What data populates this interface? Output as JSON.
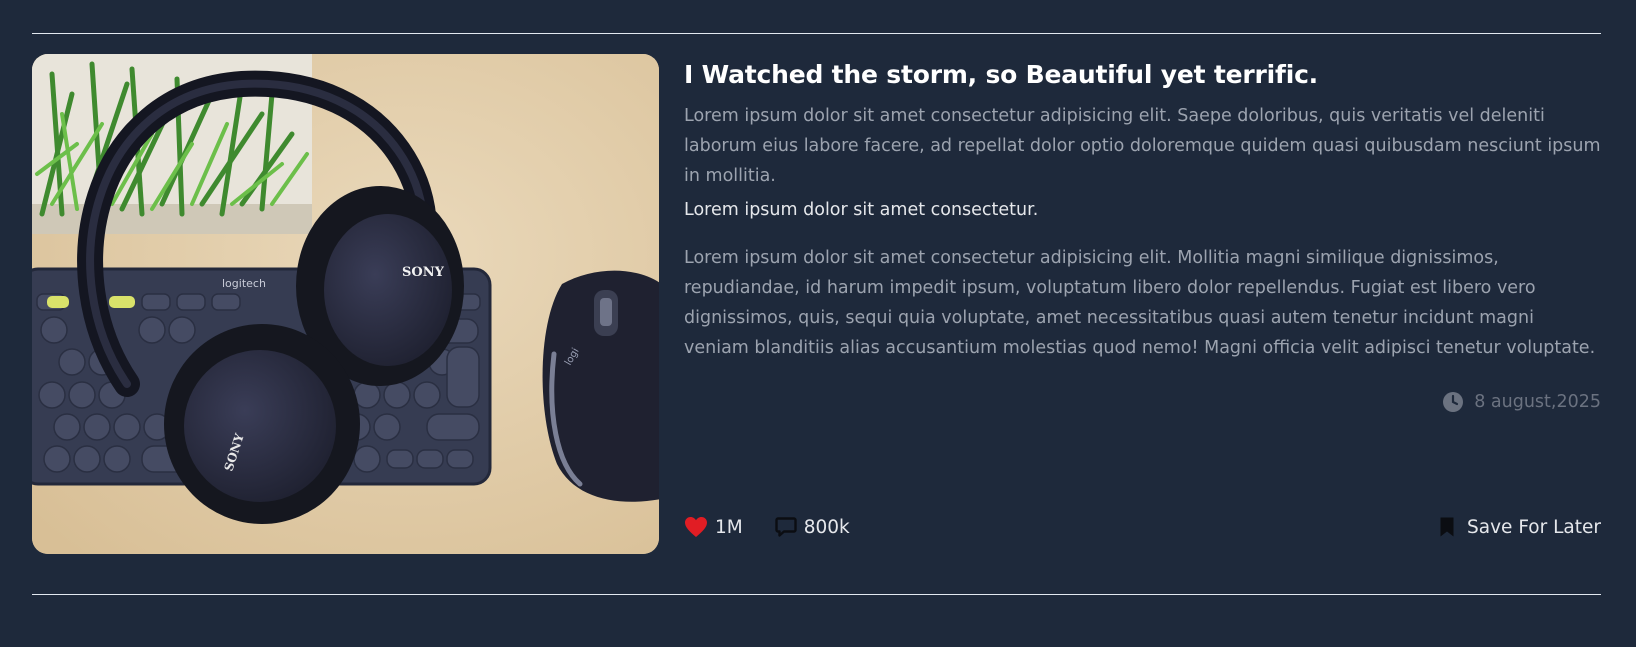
{
  "post": {
    "title": "I Watched the storm, so Beautiful yet terrific.",
    "paragraph_1": "Lorem ipsum dolor sit amet consectetur adipisicing elit. Saepe doloribus, quis veritatis vel deleniti laborum eius labore facere, ad repellat dolor optio doloremque quidem quasi quibusdam nesciunt ipsum in mollitia.",
    "subline": "Lorem ipsum dolor sit amet consectetur.",
    "paragraph_2": "Lorem ipsum dolor sit amet consectetur adipisicing elit. Mollitia magni similique dignissimos, repudiandae, id harum impedit ipsum, voluptatum libero dolor repellendus. Fugiat est libero vero dignissimos, quis, sequi quia voluptate, amet necessitatibus quasi autem tenetur incidunt magni veniam blanditiis alias accusantium molestias quod nemo! Magni officia velit adipisci tenetur voluptate.",
    "date": "8 august,2025"
  },
  "image": {
    "keyboard_brand": "logitech",
    "headphone_brand": "SONY",
    "mouse_brand": "logi"
  },
  "actions": {
    "likes": "1M",
    "comments": "800k",
    "save_label": "Save For Later"
  },
  "icons": {
    "heart": "heart-icon",
    "comment": "comment-icon",
    "bookmark": "bookmark-icon",
    "clock": "clock-icon"
  },
  "colors": {
    "background": "#1e293b",
    "heart": "#e11d24",
    "muted_text": "#9ca3af",
    "date_text": "#6b7280"
  }
}
